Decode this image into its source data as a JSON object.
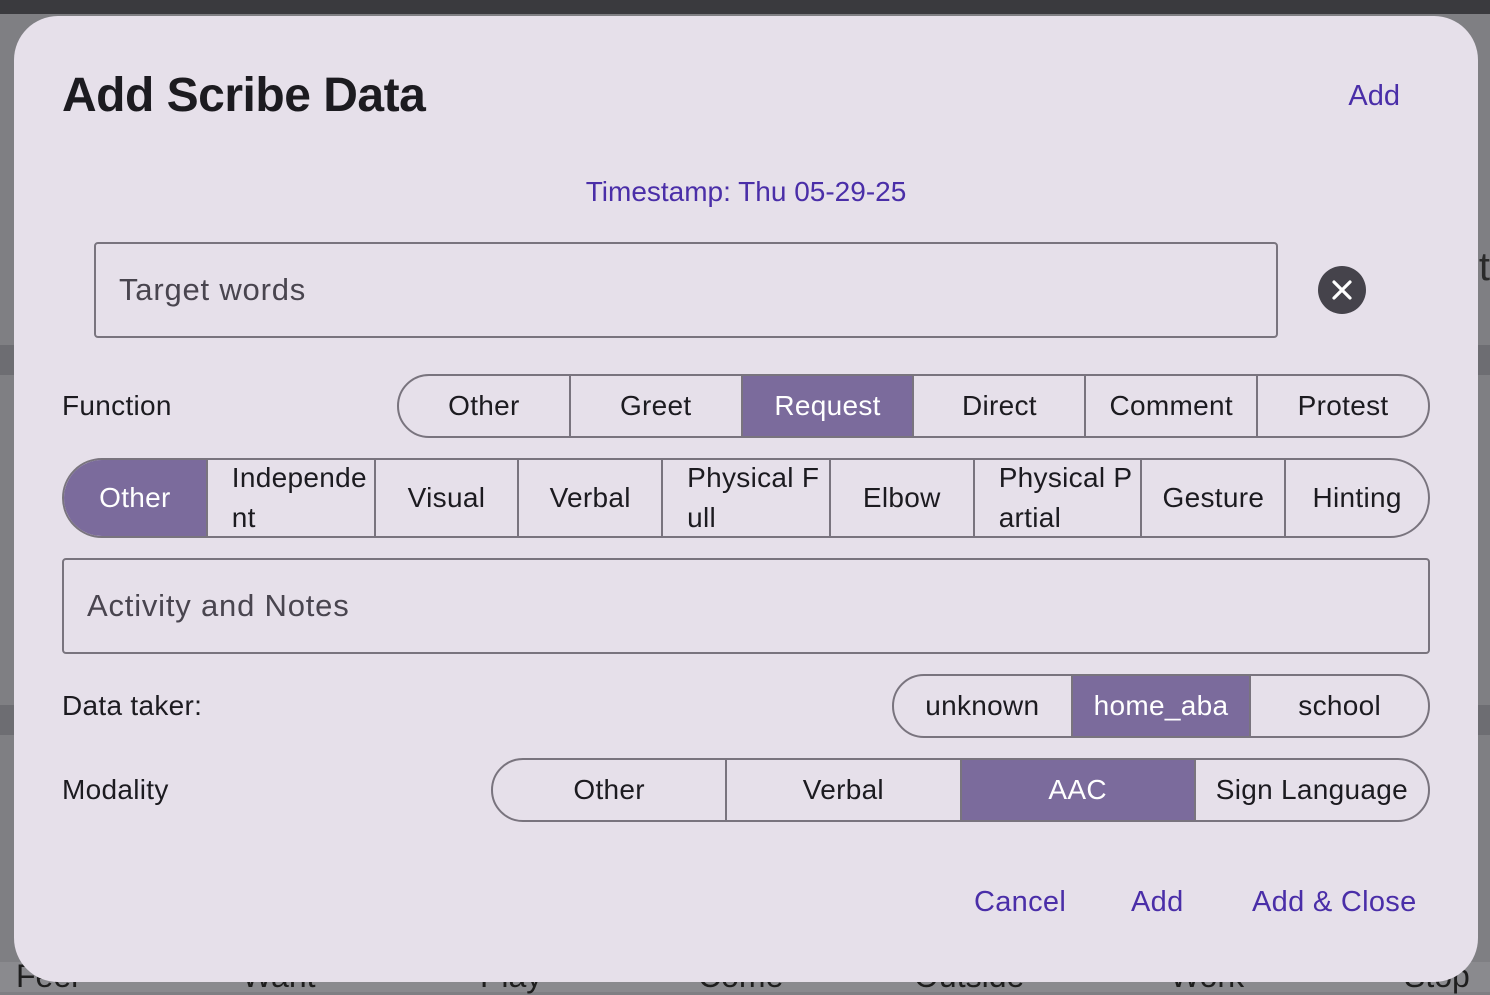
{
  "background": {
    "words": [
      "Feel",
      "Want",
      "Play",
      "Come",
      "Outside",
      "Work",
      "Stop"
    ],
    "edge_letter": "t"
  },
  "dialog": {
    "title": "Add Scribe Data",
    "top_add_label": "Add",
    "timestamp": "Timestamp: Thu 05-29-25",
    "target_words": {
      "placeholder": "Target words",
      "value": ""
    },
    "clear_icon": "close-icon",
    "function": {
      "label": "Function",
      "options": [
        "Other",
        "Greet",
        "Request",
        "Direct",
        "Comment",
        "Protest"
      ],
      "selected": "Request"
    },
    "prompt_level": {
      "options": [
        "Other",
        "Independent",
        "Visual",
        "Verbal",
        "Physical Full",
        "Elbow",
        "Physical Partial",
        "Gesture",
        "Hinting"
      ],
      "selected": "Other"
    },
    "activity_notes": {
      "placeholder": "Activity and Notes",
      "value": ""
    },
    "data_taker": {
      "label": "Data taker:",
      "options": [
        "unknown",
        "home_aba",
        "school"
      ],
      "selected": "home_aba"
    },
    "modality": {
      "label": "Modality",
      "options": [
        "Other",
        "Verbal",
        "AAC",
        "Sign Language"
      ],
      "selected": "AAC"
    },
    "footer": {
      "cancel_label": "Cancel",
      "add_label": "Add",
      "add_close_label": "Add & Close"
    }
  },
  "colors": {
    "accent_text": "#4a2ea8",
    "selected_segment": "#7b6b9c",
    "dialog_surface": "#e6e0ea"
  }
}
